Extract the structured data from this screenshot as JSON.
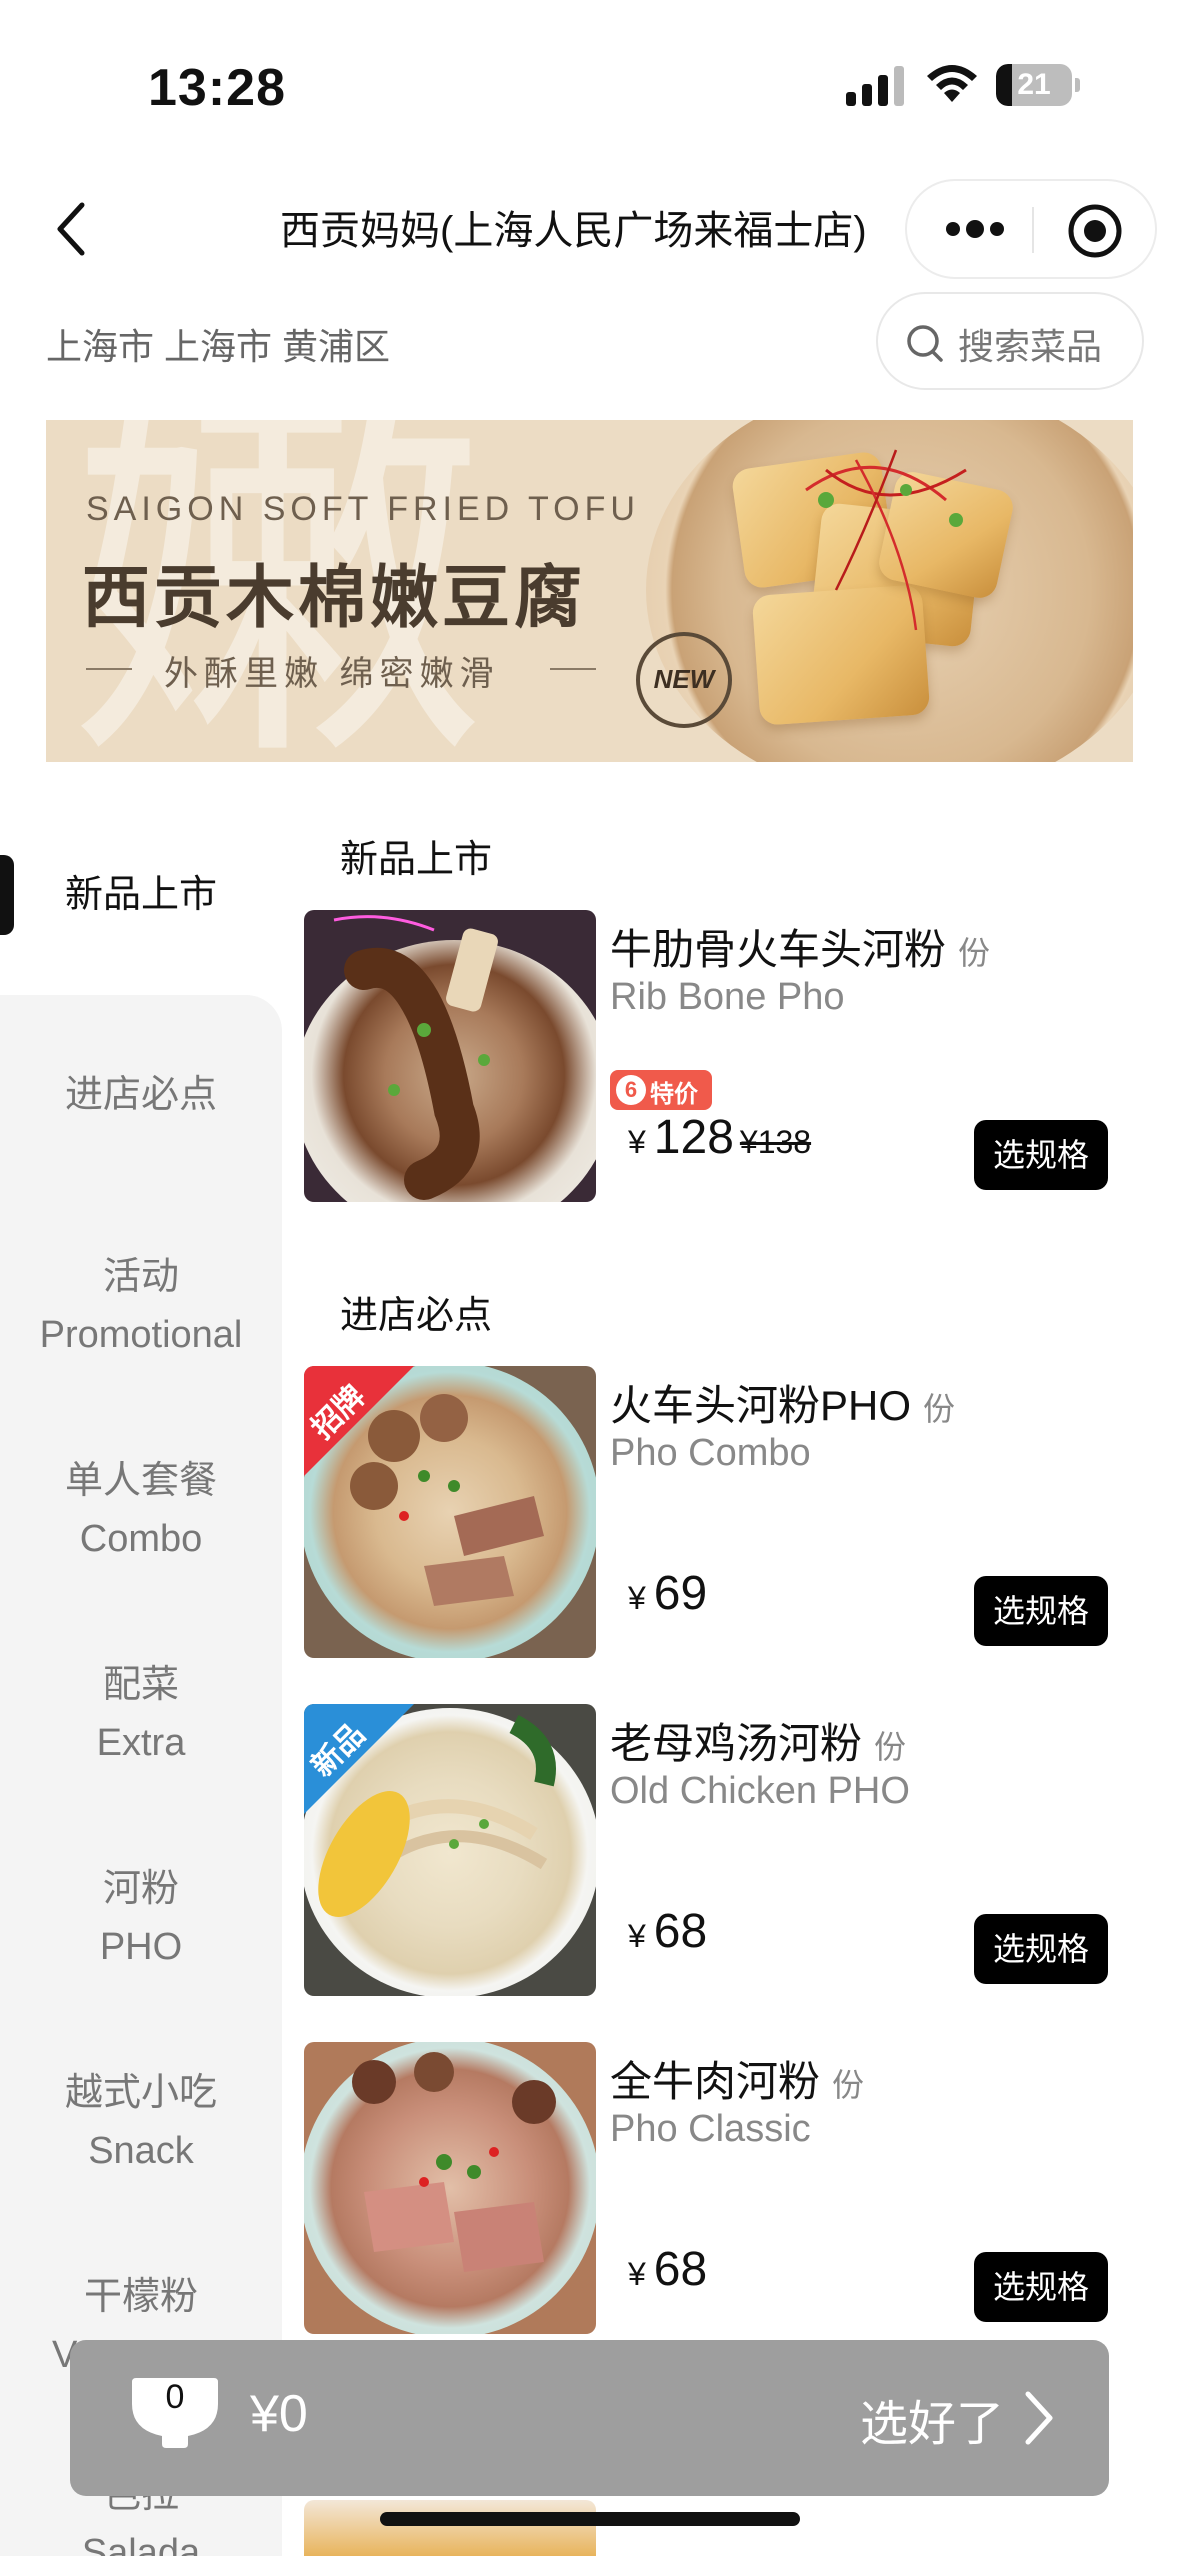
{
  "status": {
    "time": "13:28",
    "battery_level": "21",
    "battery_fraction": 0.21
  },
  "nav": {
    "title": "西贡妈妈(上海人民广场来福士店)"
  },
  "location": {
    "text": "上海市 上海市 黄浦区"
  },
  "search": {
    "placeholder": "搜索菜品"
  },
  "banner": {
    "title_en": "SAIGON SOFT FRIED TOFU",
    "title_cn": "西贡木棉嫩豆腐",
    "slogan": "外酥里嫩 绵密嫩滑",
    "badge": "NEW",
    "watermark": "嫩"
  },
  "sidebar": {
    "items": [
      {
        "cn": "新品上市",
        "en": ""
      },
      {
        "cn": "进店必点",
        "en": ""
      },
      {
        "cn": "活动",
        "en": "Promotional"
      },
      {
        "cn": "单人套餐",
        "en": "Combo"
      },
      {
        "cn": "配菜",
        "en": "Extra"
      },
      {
        "cn": "河粉",
        "en": "PHO"
      },
      {
        "cn": "越式小吃",
        "en": "Snack"
      },
      {
        "cn": "干檬粉",
        "en": "V"
      },
      {
        "cn": "色拉",
        "en": "Salada"
      }
    ]
  },
  "sections": [
    {
      "title": "新品上市",
      "products": [
        {
          "name": "牛肋骨火车头河粉",
          "unit": "份",
          "en": "Rib Bone Pho",
          "currency": "¥",
          "price": "128",
          "original_price": "¥138",
          "badge": "特价",
          "button": "选规格"
        }
      ]
    },
    {
      "title": "进店必点",
      "products": [
        {
          "name": "火车头河粉PHO",
          "unit": "份",
          "en": "Pho Combo",
          "currency": "¥",
          "price": "69",
          "corner_tag": "招牌",
          "button": "选规格"
        },
        {
          "name": "老母鸡汤河粉",
          "unit": "份",
          "en": "Old Chicken PHO",
          "currency": "¥",
          "price": "68",
          "corner_tag": "新品",
          "button": "选规格"
        },
        {
          "name": "全牛肉河粉",
          "unit": "份",
          "en": "Pho Classic",
          "currency": "¥",
          "price": "68",
          "button": "选规格"
        }
      ]
    }
  ],
  "cart": {
    "count": "0",
    "total": "¥0",
    "checkout_label": "选好了"
  },
  "colors": {
    "accent": "#000000",
    "badge_red": "#f05a4b",
    "tag_red": "#e8313a",
    "tag_blue": "#2a8fd8",
    "cart_bar": "#9e9e9e"
  }
}
